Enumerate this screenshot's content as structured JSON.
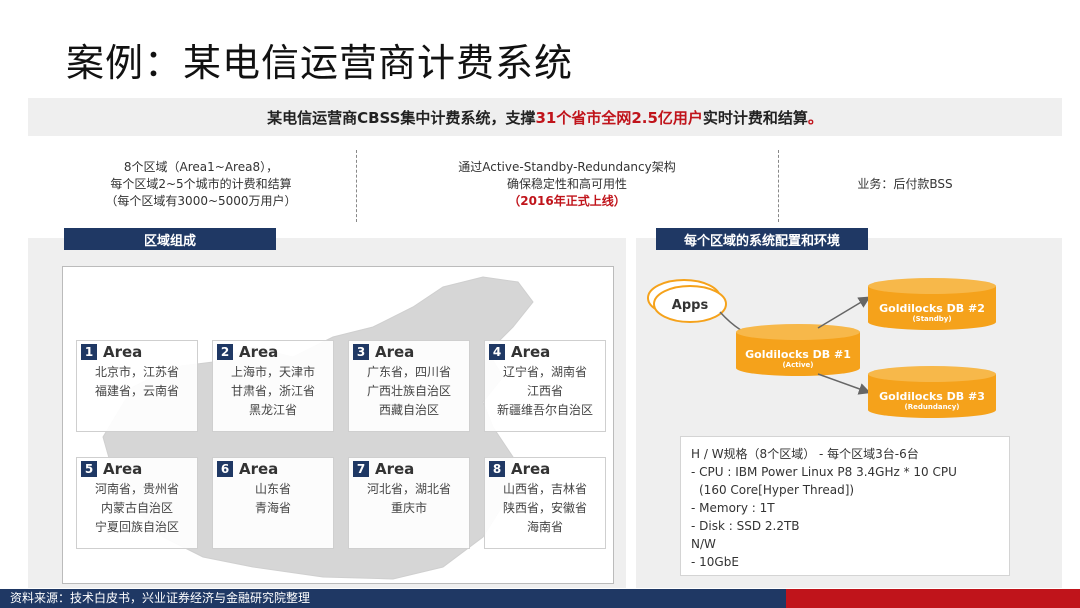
{
  "title": "案例：某电信运营商计费系统",
  "banner": {
    "part1": "某电信运营商CBSS集中计费系统，支撑",
    "highlight": "31个省市全网2.5亿用户",
    "part2": "实时计费和结算",
    "period": "。"
  },
  "info": {
    "col1": [
      "8个区域（Area1~Area8），",
      "每个区域2~5个城市的计费和结算",
      "（每个区域有3000~5000万用户）"
    ],
    "col2": [
      "通过Active-Standby-Redundancy架构",
      "确保稳定性和高可用性"
    ],
    "col2_red": "（2016年正式上线）",
    "col3": "业务：后付款BSS"
  },
  "sections": {
    "left": "区域组成",
    "right": "每个区域的系统配置和环境"
  },
  "areas": [
    {
      "num": "1",
      "label": "Area",
      "lines": [
        "北京市，江苏省",
        "福建省，云南省"
      ]
    },
    {
      "num": "2",
      "label": "Area",
      "lines": [
        "上海市，天津市",
        "甘肃省，浙江省",
        "黑龙江省"
      ]
    },
    {
      "num": "3",
      "label": "Area",
      "lines": [
        "广东省，四川省",
        "广西壮族自治区",
        "西藏自治区"
      ]
    },
    {
      "num": "4",
      "label": "Area",
      "lines": [
        "辽宁省，湖南省",
        "江西省",
        "新疆维吾尔自治区"
      ]
    },
    {
      "num": "5",
      "label": "Area",
      "lines": [
        "河南省，贵州省",
        "内蒙古自治区",
        "宁夏回族自治区"
      ]
    },
    {
      "num": "6",
      "label": "Area",
      "lines": [
        "山东省",
        "青海省"
      ]
    },
    {
      "num": "7",
      "label": "Area",
      "lines": [
        "河北省，湖北省",
        "重庆市"
      ]
    },
    {
      "num": "8",
      "label": "Area",
      "lines": [
        "山西省，吉林省",
        "陕西省，安徽省",
        "海南省"
      ]
    }
  ],
  "diagram": {
    "apps": "Apps",
    "db1": "Goldilocks DB #1",
    "db1_sub": "(Active)",
    "db2": "Goldilocks DB #2",
    "db2_sub": "(Standby)",
    "db3": "Goldilocks DB #3",
    "db3_sub": "(Redundancy)",
    "color_orange": "#f5a21b",
    "color_dark_orange": "#e48a0c"
  },
  "spec": [
    "H / W规格（8个区域） - 每个区域3台-6台",
    "- CPU : IBM Power Linux P8 3.4GHz * 10 CPU",
    "  (160  Core[Hyper Thread])",
    "- Memory : 1T",
    "- Disk : SSD 2.2TB",
    "N/W",
    "- 10GbE"
  ],
  "footer": "资料来源：技术白皮书，兴业证券经济与金融研究院整理"
}
